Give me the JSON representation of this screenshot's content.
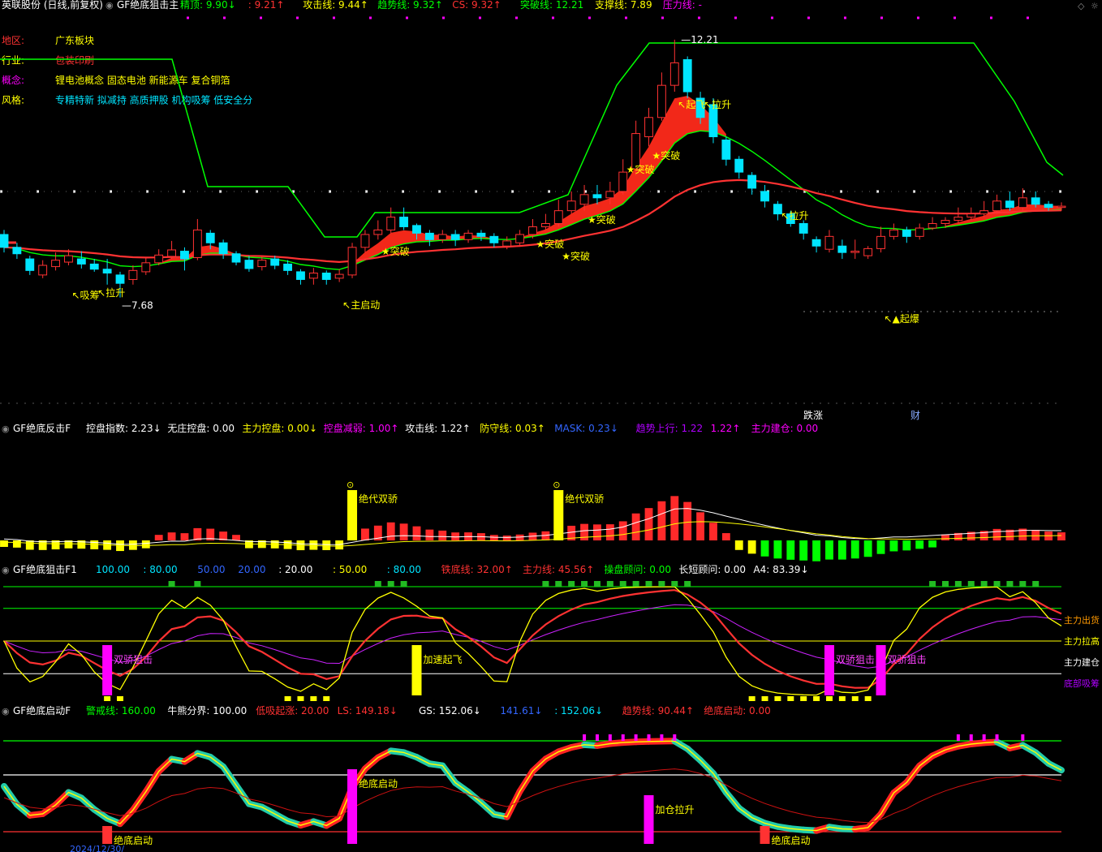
{
  "colors": {
    "bg": "#000000",
    "up": "#ff3232",
    "down": "#00e5ff",
    "yellow": "#ffff00",
    "green": "#00ff00",
    "magenta": "#ff00ff",
    "white": "#ffffff",
    "purple": "#b000ff",
    "blue": "#3366ff",
    "gray": "#aaaaaa"
  },
  "header": {
    "stock": "英联股份 (日线,前复权)",
    "indicator": "GF绝底狙击主",
    "items": [
      {
        "label": "精顶:",
        "value": "9.90↓",
        "color": "#00ff00"
      },
      {
        "label": "",
        "value": ": 9.21↑",
        "color": "#ff3232"
      },
      {
        "label": "攻击线:",
        "value": "9.44↑",
        "color": "#ffff00"
      },
      {
        "label": "趋势线:",
        "value": "9.32↑",
        "color": "#00ff00"
      },
      {
        "label": "CS:",
        "value": "9.32↑",
        "color": "#ff3232"
      },
      {
        "label": "突破线:",
        "value": "12.21",
        "color": "#00ff00"
      },
      {
        "label": "支撑线:",
        "value": "7.89",
        "color": "#ffff00"
      },
      {
        "label": "压力线:",
        "value": "-",
        "color": "#ff00ff"
      }
    ]
  },
  "info": [
    {
      "label": "地区:",
      "value": "广东板块",
      "label_color": "#ff3232",
      "value_color": "#ffff00"
    },
    {
      "label": "行业:",
      "value": "包装印刷",
      "label_color": "#ffff00",
      "value_color": "#ff3232"
    },
    {
      "label": "概念:",
      "value": "锂电池概念 固态电池 新能源车 复合铜箔",
      "label_color": "#ff00ff",
      "value_color": "#ffff00"
    },
    {
      "label": "风格:",
      "value": "专精特新 拟减持 高质押股 机构吸筹 低安全分",
      "label_color": "#ffff00",
      "value_color": "#00e5ff"
    }
  ],
  "price_labels": {
    "high": "12.21",
    "low": "7.68",
    "signals": [
      {
        "text": "↖吸筹",
        "color": "#ffff00"
      },
      {
        "text": "↖拉升",
        "color": "#ffff00"
      },
      {
        "text": "↖主启动",
        "color": "#ffff00"
      },
      {
        "text": "★突破",
        "color": "#ffff00"
      },
      {
        "text": "★突破",
        "color": "#ffff00"
      },
      {
        "text": "★突破",
        "color": "#ffff00"
      },
      {
        "text": "★突破",
        "color": "#ffff00"
      },
      {
        "text": "★突破",
        "color": "#ffff00"
      },
      {
        "text": "★突破",
        "color": "#ffff00"
      },
      {
        "text": "↖起飞",
        "color": "#ffff00"
      },
      {
        "text": "↖拉升",
        "color": "#ffff00"
      },
      {
        "text": "↖拉升",
        "color": "#ffff00"
      },
      {
        "text": "↖▲起爆",
        "color": "#ffff00"
      }
    ],
    "markers": [
      "跌涨",
      "财"
    ]
  },
  "panel2": {
    "title": "GF绝底反击F",
    "items": [
      {
        "label": "控盘指数:",
        "value": "2.23↓",
        "color": "#ffffff"
      },
      {
        "label": "无庄控盘:",
        "value": "0.00",
        "color": "#ffffff"
      },
      {
        "label": "主力控盘:",
        "value": "0.00↓",
        "color": "#ffff00"
      },
      {
        "label": "控盘减弱:",
        "value": "1.00↑",
        "color": "#ff00ff"
      },
      {
        "label": "攻击线:",
        "value": "1.22↑",
        "color": "#ffffff"
      },
      {
        "label": "防守线:",
        "value": "0.03↑",
        "color": "#ffff00"
      },
      {
        "label": "MASK:",
        "value": "0.23↓",
        "color": "#3366ff"
      },
      {
        "label": "趋势上行:",
        "value": "1.22",
        "color": "#b000ff"
      },
      {
        "label": "",
        "value": "1.22↑",
        "color": "#ff00ff"
      },
      {
        "label": "主力建仓:",
        "value": "0.00",
        "color": "#ff00ff"
      }
    ],
    "labels": [
      "绝代双骄",
      "绝代双骄"
    ]
  },
  "panel3": {
    "title": "GF绝底狙击F1",
    "items": [
      {
        "label": "",
        "value": "100.00",
        "color": "#00e5ff"
      },
      {
        "label": "",
        "value": ": 80.00",
        "color": "#00e5ff"
      },
      {
        "label": "",
        "value": "50.00",
        "color": "#3366ff"
      },
      {
        "label": "",
        "value": "20.00",
        "color": "#3366ff"
      },
      {
        "label": "",
        "value": ": 20.00",
        "color": "#ffffff"
      },
      {
        "label": "",
        "value": ": 50.00",
        "color": "#ffff00"
      },
      {
        "label": "",
        "value": ": 80.00",
        "color": "#00e5ff"
      },
      {
        "label": "铁底线:",
        "value": "32.00↑",
        "color": "#ff3232"
      },
      {
        "label": "主力线:",
        "value": "45.56↑",
        "color": "#ff3232"
      },
      {
        "label": "操盘顾问:",
        "value": "0.00",
        "color": "#00ff00"
      },
      {
        "label": "长短顾问:",
        "value": "0.00",
        "color": "#ffffff"
      },
      {
        "label": "A4:",
        "value": "83.39↓",
        "color": "#ffffff"
      }
    ],
    "labels": [
      "双骄狙击",
      "加速起飞",
      "双骄狙击",
      "双骄狙击"
    ],
    "right_labels": [
      {
        "text": "主力出货",
        "color": "#ff9900"
      },
      {
        "text": "主力拉高",
        "color": "#ffff00"
      },
      {
        "text": "主力建仓",
        "color": "#ffffff"
      },
      {
        "text": "底部吸筹",
        "color": "#b000ff"
      }
    ]
  },
  "panel4": {
    "title": "GF绝底启动F",
    "items": [
      {
        "label": "警戒线:",
        "value": "160.00",
        "color": "#00ff00"
      },
      {
        "label": "牛熊分界:",
        "value": "100.00",
        "color": "#ffffff"
      },
      {
        "label": "低吸起涨:",
        "value": "20.00",
        "color": "#ff3232"
      },
      {
        "label": "LS:",
        "value": "149.18↓",
        "color": "#ff3232"
      },
      {
        "label": "GS:",
        "value": "152.06↓",
        "color": "#ffffff"
      },
      {
        "label": "",
        "value": "141.61↓",
        "color": "#3366ff"
      },
      {
        "label": "",
        "value": ": 152.06↓",
        "color": "#00e5ff"
      },
      {
        "label": "趋势线:",
        "value": "90.44↑",
        "color": "#ff3232"
      },
      {
        "label": "绝底启动:",
        "value": "0.00",
        "color": "#ff3232"
      }
    ],
    "labels": [
      "绝底启动",
      "绝底启动",
      "加仓拉升",
      "绝底启动"
    ]
  },
  "footer": {
    "date": "2024/12/30/"
  },
  "chart_data": [
    {
      "type": "candlestick",
      "title": "英联股份 (日线,前复权)",
      "ylim": [
        7.4,
        12.6
      ],
      "candles": [
        [
          9.18,
          8.98,
          9.25,
          8.9
        ],
        [
          8.98,
          8.88,
          9.05,
          8.8
        ],
        [
          8.8,
          8.62,
          8.85,
          8.55
        ],
        [
          8.55,
          8.7,
          8.78,
          8.5
        ],
        [
          8.68,
          8.78,
          8.9,
          8.62
        ],
        [
          8.75,
          8.85,
          8.95,
          8.7
        ],
        [
          8.8,
          8.72,
          8.92,
          8.65
        ],
        [
          8.72,
          8.64,
          8.8,
          8.6
        ],
        [
          8.64,
          8.58,
          8.8,
          8.4
        ],
        [
          8.55,
          8.42,
          8.6,
          8.2
        ],
        [
          8.48,
          8.62,
          8.7,
          8.4
        ],
        [
          8.6,
          8.74,
          8.82,
          8.55
        ],
        [
          8.74,
          8.86,
          8.95,
          8.7
        ],
        [
          8.84,
          8.94,
          9.08,
          8.8
        ],
        [
          8.92,
          8.8,
          8.98,
          8.62
        ],
        [
          8.82,
          9.25,
          9.42,
          8.78
        ],
        [
          9.2,
          9.05,
          9.25,
          8.95
        ],
        [
          9.05,
          8.88,
          9.1,
          8.8
        ],
        [
          8.88,
          8.75,
          8.92,
          8.7
        ],
        [
          8.78,
          8.65,
          8.85,
          8.6
        ],
        [
          8.68,
          8.78,
          8.85,
          8.62
        ],
        [
          8.8,
          8.7,
          8.85,
          8.64
        ],
        [
          8.72,
          8.62,
          8.78,
          8.55
        ],
        [
          8.6,
          8.48,
          8.64,
          8.4
        ],
        [
          8.5,
          8.58,
          8.66,
          8.4
        ],
        [
          8.58,
          8.48,
          8.62,
          8.4
        ],
        [
          8.5,
          8.56,
          8.64,
          8.44
        ],
        [
          8.55,
          8.98,
          9.05,
          8.5
        ],
        [
          8.98,
          9.18,
          9.25,
          8.9
        ],
        [
          9.18,
          9.25,
          9.4,
          9.1
        ],
        [
          9.25,
          9.45,
          9.6,
          9.2
        ],
        [
          9.45,
          9.3,
          9.6,
          9.25
        ],
        [
          9.32,
          9.2,
          9.35,
          9.1
        ],
        [
          9.2,
          9.1,
          9.25,
          9.0
        ],
        [
          9.1,
          9.18,
          9.25,
          9.05
        ],
        [
          9.18,
          9.1,
          9.25,
          9.0
        ],
        [
          9.1,
          9.2,
          9.25,
          9.05
        ],
        [
          9.2,
          9.15,
          9.25,
          9.08
        ],
        [
          9.15,
          9.05,
          9.2,
          8.98
        ],
        [
          9.0,
          9.08,
          9.15,
          8.95
        ],
        [
          9.05,
          9.18,
          9.25,
          9.0
        ],
        [
          9.18,
          9.3,
          9.42,
          9.12
        ],
        [
          9.3,
          9.35,
          9.5,
          9.25
        ],
        [
          9.35,
          9.55,
          9.72,
          9.3
        ],
        [
          9.55,
          9.7,
          9.85,
          9.5
        ],
        [
          9.65,
          9.8,
          9.95,
          9.55
        ],
        [
          9.8,
          9.75,
          9.95,
          9.65
        ],
        [
          9.75,
          9.85,
          10.0,
          9.65
        ],
        [
          9.85,
          10.15,
          10.35,
          9.8
        ],
        [
          10.2,
          10.75,
          10.95,
          10.1
        ],
        [
          10.7,
          11.0,
          11.15,
          10.55
        ],
        [
          11.0,
          11.5,
          11.7,
          10.95
        ],
        [
          11.5,
          11.85,
          12.21,
          11.4
        ],
        [
          11.9,
          11.4,
          11.95,
          11.3
        ],
        [
          11.3,
          11.0,
          11.4,
          10.9
        ],
        [
          11.2,
          10.7,
          11.3,
          10.6
        ],
        [
          10.65,
          10.35,
          10.7,
          10.25
        ],
        [
          10.35,
          10.15,
          10.4,
          10.05
        ],
        [
          10.1,
          9.9,
          10.15,
          9.8
        ],
        [
          9.85,
          9.7,
          9.95,
          9.6
        ],
        [
          9.65,
          9.5,
          9.7,
          9.4
        ],
        [
          9.5,
          9.35,
          9.55,
          9.3
        ],
        [
          9.35,
          9.2,
          9.4,
          9.1
        ],
        [
          9.1,
          9.0,
          9.15,
          8.9
        ],
        [
          8.95,
          9.15,
          9.25,
          8.9
        ],
        [
          9.0,
          8.9,
          9.1,
          8.8
        ],
        [
          8.9,
          8.92,
          9.1,
          8.8
        ],
        [
          8.85,
          8.96,
          9.0,
          8.8
        ],
        [
          8.96,
          9.15,
          9.3,
          8.9
        ],
        [
          9.15,
          9.25,
          9.35,
          9.1
        ],
        [
          9.25,
          9.15,
          9.3,
          9.05
        ],
        [
          9.15,
          9.28,
          9.35,
          9.1
        ],
        [
          9.28,
          9.35,
          9.45,
          9.25
        ],
        [
          9.35,
          9.4,
          9.45,
          9.28
        ],
        [
          9.4,
          9.45,
          9.6,
          9.35
        ],
        [
          9.45,
          9.5,
          9.6,
          9.4
        ],
        [
          9.5,
          9.55,
          9.7,
          9.45
        ],
        [
          9.55,
          9.7,
          9.8,
          9.5
        ],
        [
          9.7,
          9.6,
          9.85,
          9.55
        ],
        [
          9.6,
          9.75,
          9.9,
          9.55
        ],
        [
          9.75,
          9.65,
          9.85,
          9.6
        ],
        [
          9.65,
          9.6,
          9.7,
          9.55
        ],
        [
          9.6,
          9.62,
          9.68,
          9.55
        ]
      ]
    }
  ]
}
